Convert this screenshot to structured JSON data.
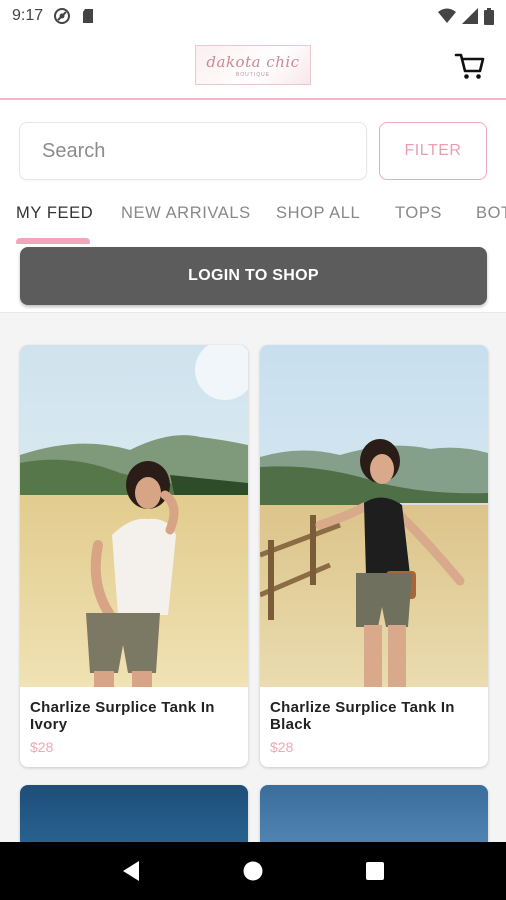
{
  "status_bar": {
    "time": "9:17",
    "icons": [
      "at-sign-icon",
      "sd-card-icon",
      "wifi-icon",
      "signal-icon",
      "battery-icon"
    ]
  },
  "header": {
    "logo_text": "dakota chic",
    "logo_subtext": "BOUTIQUE",
    "cart_icon": "shopping-cart-icon"
  },
  "search": {
    "placeholder": "Search",
    "value": "",
    "filter_label": "FILTER"
  },
  "tabs": [
    {
      "label": "MY FEED",
      "active": true
    },
    {
      "label": "NEW ARRIVALS",
      "active": false
    },
    {
      "label": "SHOP ALL",
      "active": false
    },
    {
      "label": "TOPS",
      "active": false
    },
    {
      "label": "BOTTOMS",
      "active": false
    }
  ],
  "login": {
    "label": "LOGIN TO SHOP"
  },
  "products": [
    {
      "title": "Charlize Surplice Tank In Ivory",
      "price": "$28"
    },
    {
      "title": "Charlize Surplice Tank In Black",
      "price": "$28"
    }
  ],
  "colors": {
    "accent_pink": "#f3a6b9",
    "price_pink": "#f0a7b8",
    "login_button": "#5c5c5c",
    "nav_bar": "#000000"
  },
  "nav_bar": {
    "icons": [
      "back-icon",
      "home-icon",
      "recents-icon"
    ]
  }
}
